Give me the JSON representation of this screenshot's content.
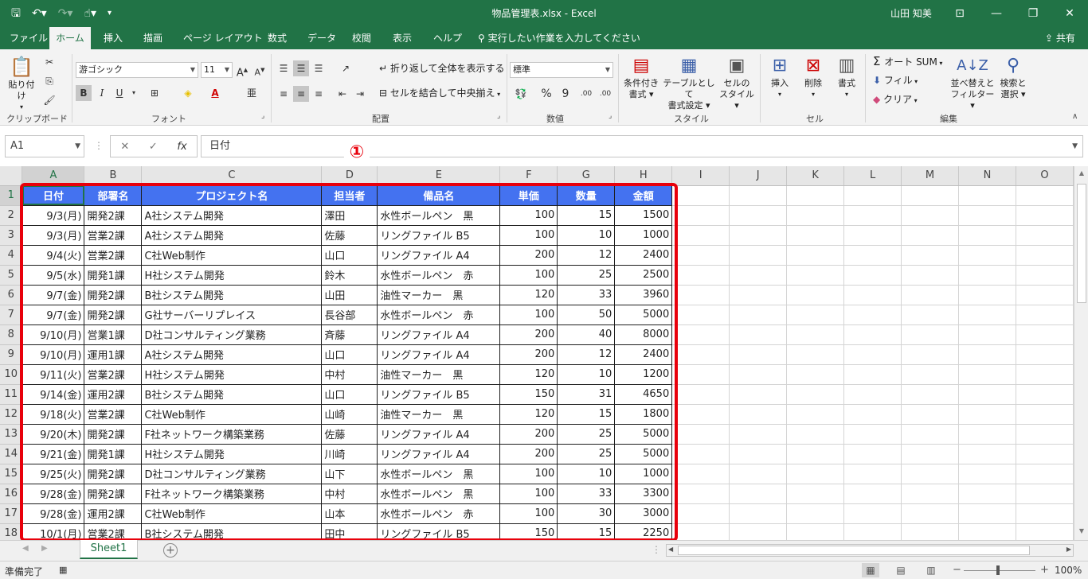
{
  "window": {
    "title": "物品管理表.xlsx  -  Excel",
    "user": "山田 知美",
    "qat_save": "🖫",
    "qat_undo": "↶▾",
    "qat_redo": "↷▾",
    "qat_touch": "☝▾",
    "qat_more": "▾",
    "ribbon_display": "⊡",
    "minimize": "—",
    "restore": "❐",
    "close": "✕"
  },
  "tabs": [
    "ファイル",
    "ホーム",
    "挿入",
    "描画",
    "ページ レイアウト",
    "数式",
    "データ",
    "校閲",
    "表示",
    "ヘルプ"
  ],
  "tell_me": "実行したい作業を入力してください",
  "share": "共有",
  "ribbon": {
    "clipboard": {
      "label": "クリップボード",
      "paste": "貼り付け"
    },
    "font": {
      "label": "フォント",
      "name": "游ゴシック",
      "size": "11",
      "bold": "B",
      "italic": "I",
      "underline": "U"
    },
    "alignment": {
      "label": "配置",
      "wrap": "折り返して全体を表示する",
      "merge": "セルを結合して中央揃え"
    },
    "number": {
      "label": "数値",
      "format": "標準",
      "percent": "%",
      "comma": "9",
      "inc": ".00",
      "dec": ".00"
    },
    "styles": {
      "label": "スタイル",
      "cond1": "条件付き",
      "cond2": "書式",
      "table1": "テーブルとして",
      "table2": "書式設定",
      "cell1": "セルの",
      "cell2": "スタイル"
    },
    "cells": {
      "label": "セル",
      "insert": "挿入",
      "delete": "削除",
      "format": "書式"
    },
    "editing": {
      "label": "編集",
      "autosum": "オート SUM",
      "fill": "フィル",
      "clear": "クリア",
      "sort1": "並べ替えと",
      "sort2": "フィルター",
      "find1": "検索と",
      "find2": "選択"
    }
  },
  "formula": {
    "cell_ref": "A1",
    "content": "日付",
    "cancel": "✕",
    "enter": "✓",
    "fx": "fx"
  },
  "annotation": "①",
  "columns": [
    "A",
    "B",
    "C",
    "D",
    "E",
    "F",
    "G",
    "H",
    "I",
    "J",
    "K",
    "L",
    "M",
    "N",
    "O"
  ],
  "table": {
    "headers": [
      "日付",
      "部署名",
      "プロジェクト名",
      "担当者",
      "備品名",
      "単価",
      "数量",
      "金額"
    ],
    "rows": [
      [
        "9/3(月)",
        "開発2課",
        "A社システム開発",
        "澤田",
        "水性ボールペン　黒",
        "100",
        "15",
        "1500"
      ],
      [
        "9/3(月)",
        "営業2課",
        "A社システム開発",
        "佐藤",
        "リングファイル B5",
        "100",
        "10",
        "1000"
      ],
      [
        "9/4(火)",
        "営業2課",
        "C社Web制作",
        "山口",
        "リングファイル A4",
        "200",
        "12",
        "2400"
      ],
      [
        "9/5(水)",
        "開発1課",
        "H社システム開発",
        "鈴木",
        "水性ボールペン　赤",
        "100",
        "25",
        "2500"
      ],
      [
        "9/7(金)",
        "開発2課",
        "B社システム開発",
        "山田",
        "油性マーカー　黒",
        "120",
        "33",
        "3960"
      ],
      [
        "9/7(金)",
        "開発2課",
        "G社サーバーリプレイス",
        "長谷部",
        "水性ボールペン　赤",
        "100",
        "50",
        "5000"
      ],
      [
        "9/10(月)",
        "営業1課",
        "D社コンサルティング業務",
        "斉藤",
        "リングファイル A4",
        "200",
        "40",
        "8000"
      ],
      [
        "9/10(月)",
        "運用1課",
        "A社システム開発",
        "山口",
        "リングファイル A4",
        "200",
        "12",
        "2400"
      ],
      [
        "9/11(火)",
        "営業2課",
        "H社システム開発",
        "中村",
        "油性マーカー　黒",
        "120",
        "10",
        "1200"
      ],
      [
        "9/14(金)",
        "運用2課",
        "B社システム開発",
        "山口",
        "リングファイル B5",
        "150",
        "31",
        "4650"
      ],
      [
        "9/18(火)",
        "営業2課",
        "C社Web制作",
        "山崎",
        "油性マーカー　黒",
        "120",
        "15",
        "1800"
      ],
      [
        "9/20(木)",
        "開発2課",
        "F社ネットワーク構築業務",
        "佐藤",
        "リングファイル A4",
        "200",
        "25",
        "5000"
      ],
      [
        "9/21(金)",
        "開発1課",
        "H社システム開発",
        "川崎",
        "リングファイル A4",
        "200",
        "25",
        "5000"
      ],
      [
        "9/25(火)",
        "開発2課",
        "D社コンサルティング業務",
        "山下",
        "水性ボールペン　黒",
        "100",
        "10",
        "1000"
      ],
      [
        "9/28(金)",
        "開発2課",
        "F社ネットワーク構築業務",
        "中村",
        "水性ボールペン　黒",
        "100",
        "33",
        "3300"
      ],
      [
        "9/28(金)",
        "運用2課",
        "C社Web制作",
        "山本",
        "水性ボールペン　赤",
        "100",
        "30",
        "3000"
      ],
      [
        "10/1(月)",
        "営業2課",
        "B社システム開発",
        "田中",
        "リングファイル B5",
        "150",
        "15",
        "2250"
      ]
    ]
  },
  "sheet_tab": "Sheet1",
  "add_sheet": "+",
  "status": {
    "ready": "準備完了",
    "zoom": "100%",
    "minus": "−",
    "plus": "+"
  },
  "colors": {
    "excel_green": "#217346",
    "header_blue": "#4472f0",
    "highlight_red": "#e8000b"
  }
}
